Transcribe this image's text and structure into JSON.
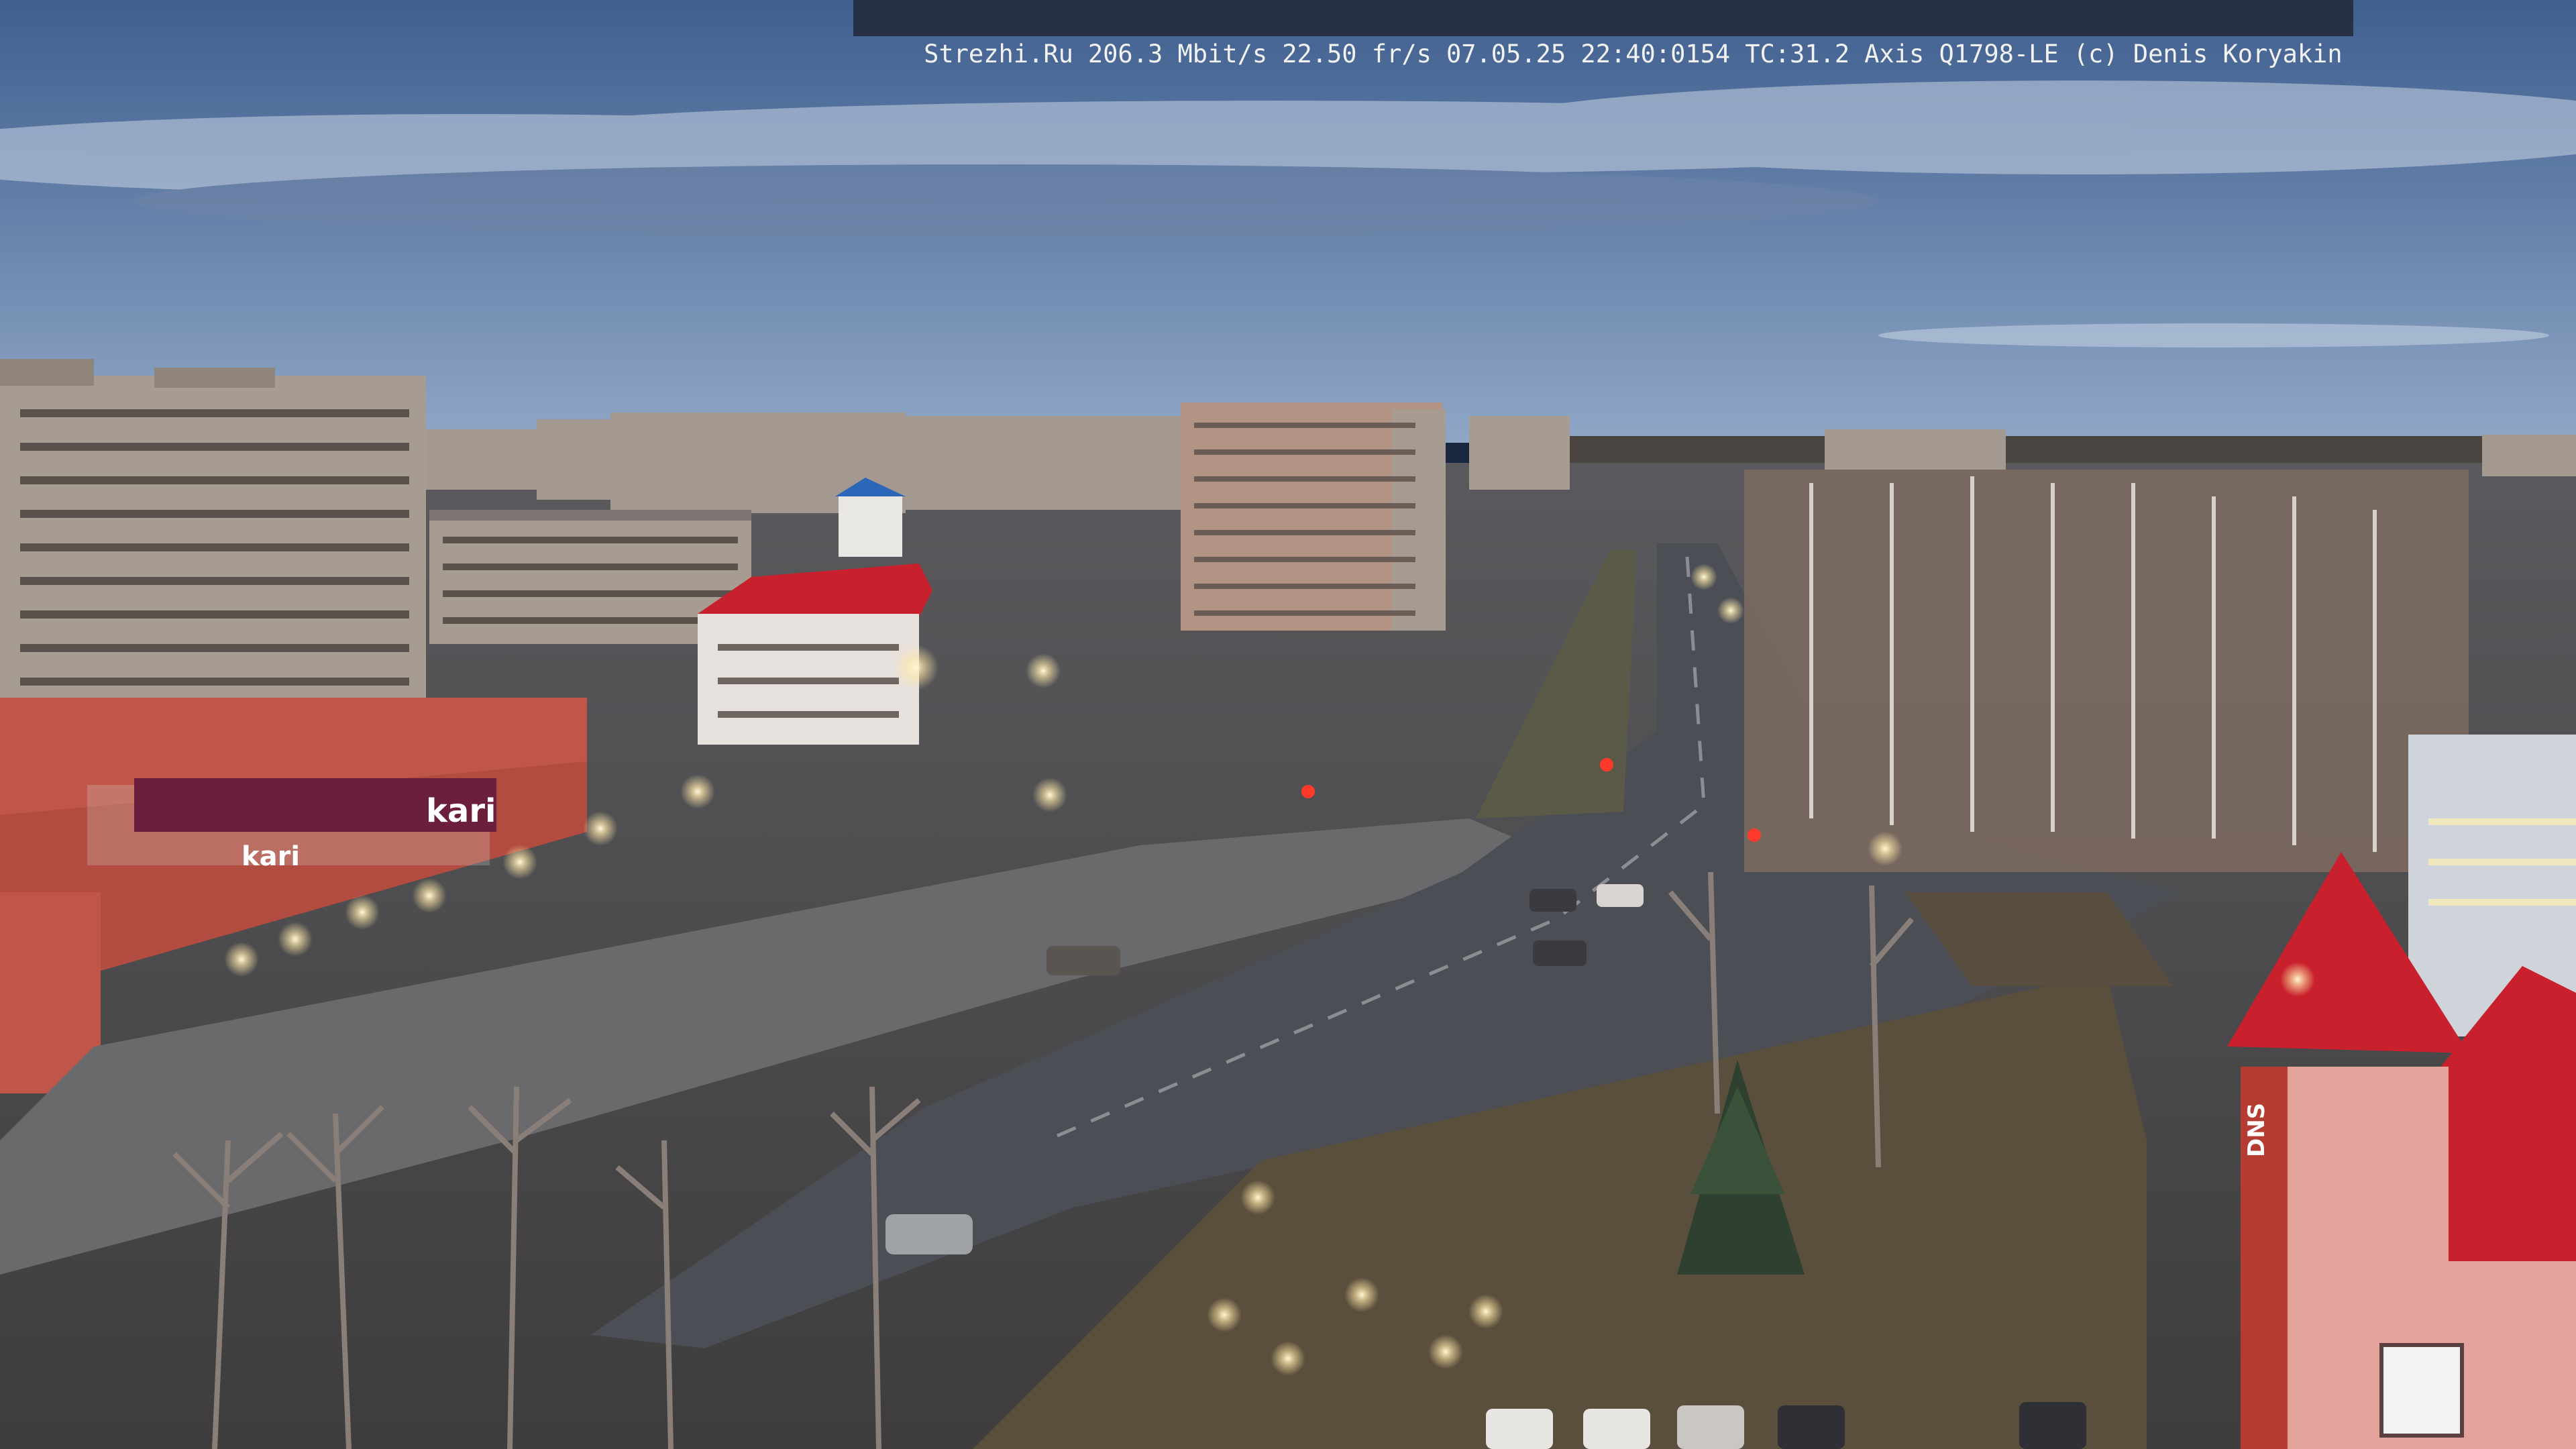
{
  "overlay": {
    "site": "Strezhi.Ru",
    "bitrate": "206.3 Mbit/s",
    "framerate": "22.50 fr/s",
    "datetime": "07.05.25 22:40:0154",
    "tc": "TC:31.2",
    "camera": "Axis Q1798-LE",
    "credit": "(c) Denis Koryakin"
  },
  "scene": {
    "storefront_sign": "kari",
    "corner_sign": "DNS",
    "colors": {
      "sky_top": "#3f5f8f",
      "sky_horizon": "#8fa6c6",
      "clouds": "#c9d3e3",
      "road": "#4b4e55",
      "storefront": "#c0564a",
      "red_roof": "#c8202d",
      "apartment_blocks": "#a79c92",
      "trees": "#7c6b60"
    }
  }
}
